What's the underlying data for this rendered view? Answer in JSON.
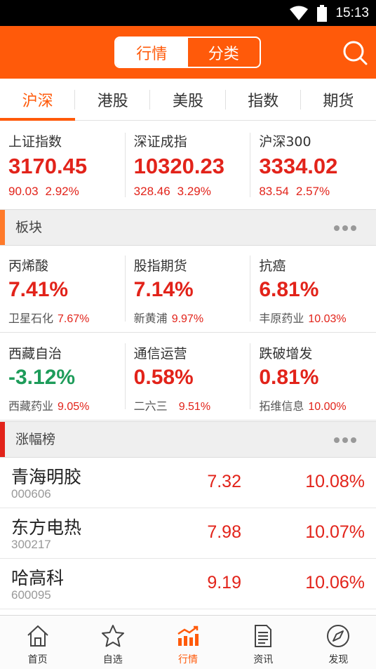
{
  "status_bar": {
    "time": "15:13",
    "wifi_icon": "wifi-icon",
    "battery_icon": "battery-icon"
  },
  "header": {
    "segments": [
      {
        "label": "行情",
        "active": true
      },
      {
        "label": "分类",
        "active": false
      }
    ],
    "search_icon": "search-icon",
    "brand_color": "#ff5a0a"
  },
  "tabs": [
    {
      "label": "沪深",
      "active": true
    },
    {
      "label": "港股",
      "active": false
    },
    {
      "label": "美股",
      "active": false
    },
    {
      "label": "指数",
      "active": false
    },
    {
      "label": "期货",
      "active": false
    }
  ],
  "indices": [
    {
      "name": "上证指数",
      "value": "3170.45",
      "change": "90.03",
      "pct": "2.92%"
    },
    {
      "name": "深证成指",
      "value": "10320.23",
      "change": "328.46",
      "pct": "3.29%"
    },
    {
      "name": "沪深300",
      "value": "3334.02",
      "change": "83.54",
      "pct": "2.57%"
    }
  ],
  "sectors_section": {
    "title": "板块",
    "accent": "#ff7a2a"
  },
  "sectors": [
    {
      "name": "丙烯酸",
      "pct": "7.41%",
      "stock": "卫星石化",
      "stock_pct": "7.67%",
      "dir": "up"
    },
    {
      "name": "股指期货",
      "pct": "7.14%",
      "stock": "新黄浦",
      "stock_pct": "9.97%",
      "dir": "up"
    },
    {
      "name": "抗癌",
      "pct": "6.81%",
      "stock": "丰原药业",
      "stock_pct": "10.03%",
      "dir": "up"
    },
    {
      "name": "西藏自治",
      "pct": "-3.12%",
      "stock": "西藏药业",
      "stock_pct": "9.05%",
      "dir": "down"
    },
    {
      "name": "通信运营",
      "pct": "0.58%",
      "stock": "二六三",
      "stock_pct": "9.51%",
      "dir": "up"
    },
    {
      "name": "跌破增发",
      "pct": "0.81%",
      "stock": "拓维信息",
      "stock_pct": "10.00%",
      "dir": "up"
    }
  ],
  "gainers_section": {
    "title": "涨幅榜",
    "accent": "#e2231a"
  },
  "gainers": [
    {
      "name": "青海明胶",
      "code": "000606",
      "price": "7.32",
      "pct": "10.08%"
    },
    {
      "name": "东方电热",
      "code": "300217",
      "price": "7.98",
      "pct": "10.07%"
    },
    {
      "name": "哈高科",
      "code": "600095",
      "price": "9.19",
      "pct": "10.06%"
    }
  ],
  "bottom_nav": [
    {
      "label": "首页",
      "icon": "home-icon",
      "active": false
    },
    {
      "label": "自选",
      "icon": "star-icon",
      "active": false
    },
    {
      "label": "行情",
      "icon": "market-chart-icon",
      "active": true
    },
    {
      "label": "资讯",
      "icon": "news-document-icon",
      "active": false
    },
    {
      "label": "发现",
      "icon": "compass-icon",
      "active": false
    }
  ],
  "colors": {
    "up": "#e2231a",
    "down": "#1e9c5a"
  }
}
